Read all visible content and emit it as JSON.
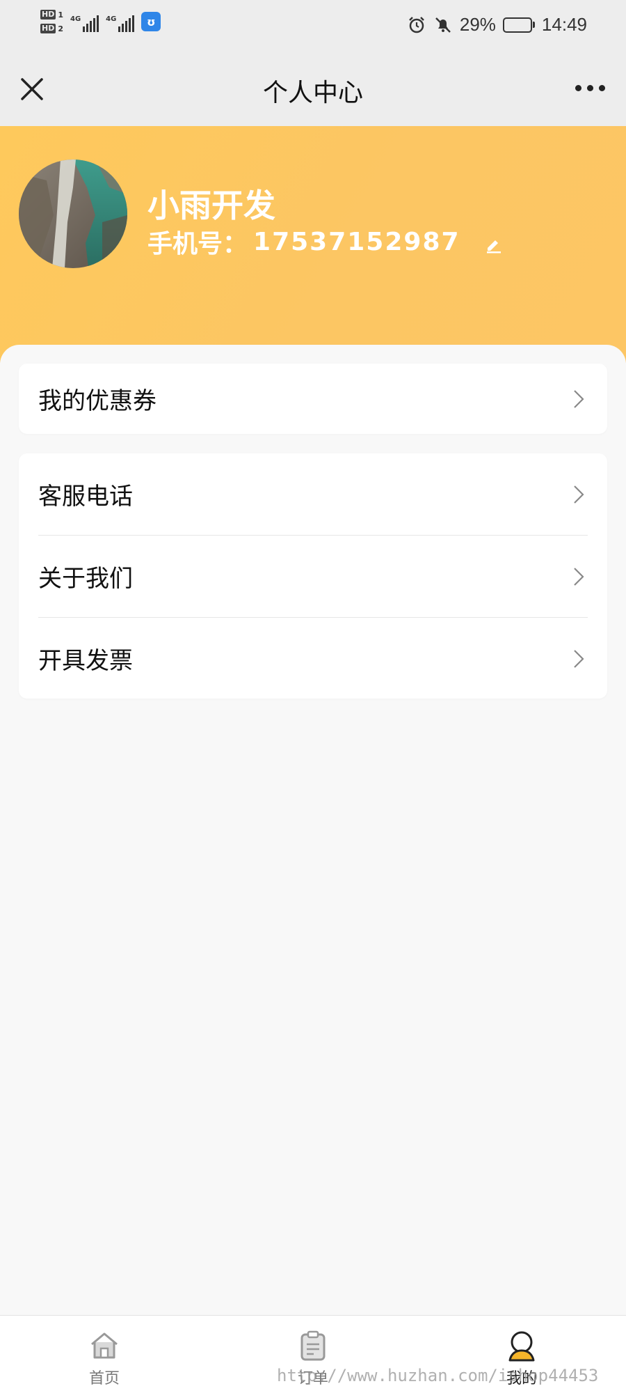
{
  "status_bar": {
    "sim1_label": "HD",
    "sim1_index": "1",
    "sim2_label": "HD",
    "sim2_index": "2",
    "network1": "4G",
    "network2": "4G",
    "battery_percent_text": "29%",
    "battery_level": 0.29,
    "time": "14:49",
    "app_icon_glyph": "ʊ"
  },
  "nav": {
    "title": "个人中心",
    "close_icon": "close-icon",
    "more_icon": "more-dots-icon"
  },
  "profile": {
    "name": "小雨开发",
    "phone_label": "手机号：",
    "phone_value": "17537152987",
    "edit_icon": "edit-pencil-icon"
  },
  "menu": {
    "coupon": "我的优惠券",
    "customer_service": "客服电话",
    "about_us": "关于我们",
    "invoice": "开具发票"
  },
  "tabs": [
    {
      "label": "首页",
      "icon": "home-icon"
    },
    {
      "label": "订单",
      "icon": "clipboard-icon"
    },
    {
      "label": "我的",
      "icon": "user-icon"
    }
  ],
  "watermark": "http://www.huzhan.com/ishop44453",
  "colors": {
    "header_yellow": "#fdc862",
    "accent_gold": "#f6b52a",
    "page_bg": "#f8f8f8"
  }
}
